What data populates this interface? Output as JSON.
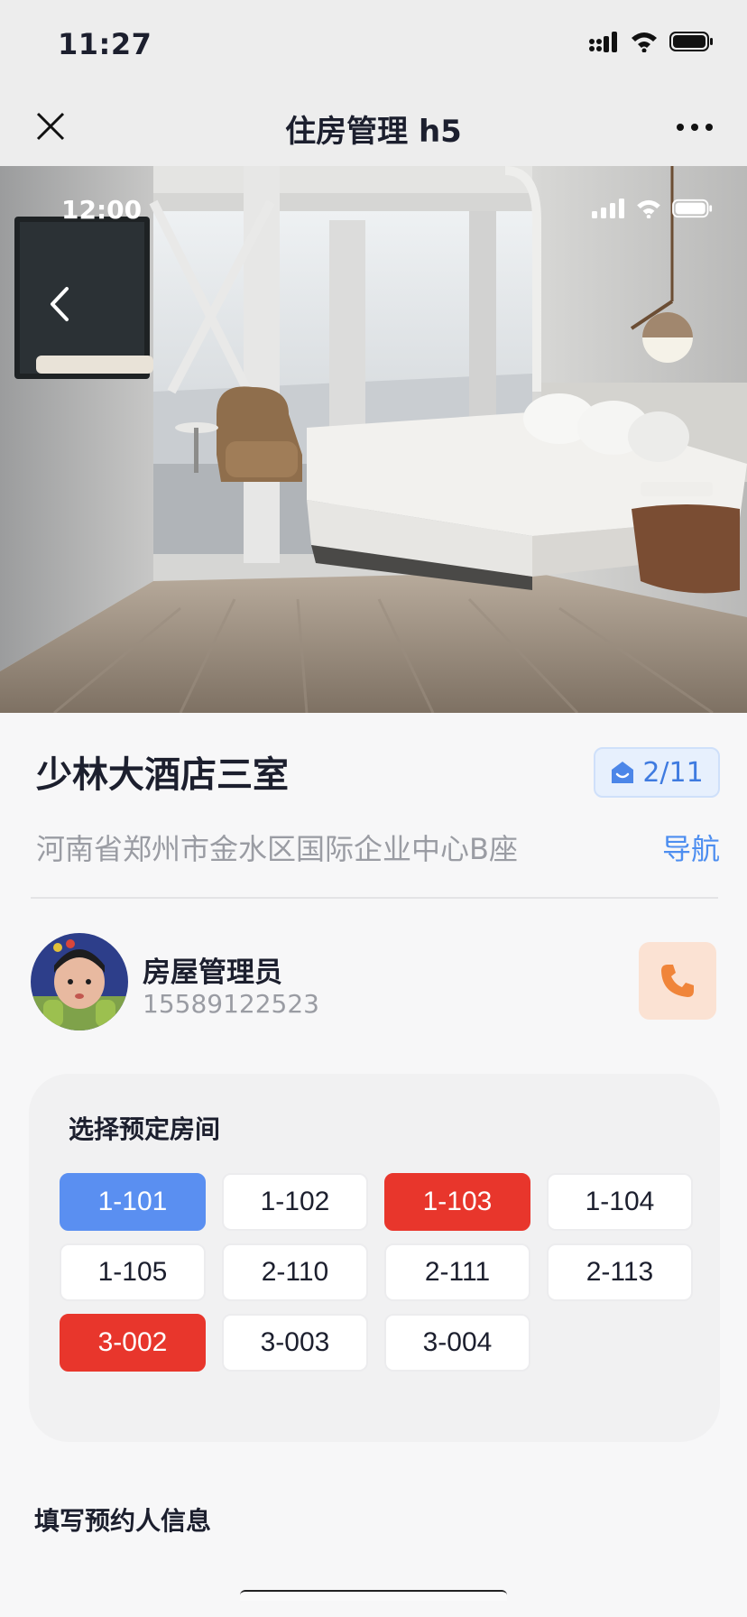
{
  "status_bar": {
    "time": "11:27"
  },
  "nav": {
    "title": "住房管理 h5"
  },
  "hero": {
    "time": "12:00"
  },
  "hotel": {
    "name": "少林大酒店三室",
    "room_count": "2/11",
    "address": "河南省郑州市金水区国际企业中心B座",
    "nav_label": "导航"
  },
  "manager": {
    "title": "房屋管理员",
    "phone": "15589122523"
  },
  "rooms": {
    "title": "选择预定房间",
    "items": [
      {
        "label": "1-101",
        "state": "selected"
      },
      {
        "label": "1-102",
        "state": "available"
      },
      {
        "label": "1-103",
        "state": "booked"
      },
      {
        "label": "1-104",
        "state": "available"
      },
      {
        "label": "1-105",
        "state": "available"
      },
      {
        "label": "2-110",
        "state": "available"
      },
      {
        "label": "2-111",
        "state": "available"
      },
      {
        "label": "2-113",
        "state": "available"
      },
      {
        "label": "3-002",
        "state": "booked"
      },
      {
        "label": "3-003",
        "state": "available"
      },
      {
        "label": "3-004",
        "state": "available"
      }
    ]
  },
  "booking": {
    "section_title": "填写预约人信息"
  },
  "colors": {
    "accent": "#5a8ff1",
    "booked": "#e8362c",
    "link": "#4d8ef0",
    "call_bg": "#fbe2d3",
    "call_icon": "#f0853a"
  }
}
